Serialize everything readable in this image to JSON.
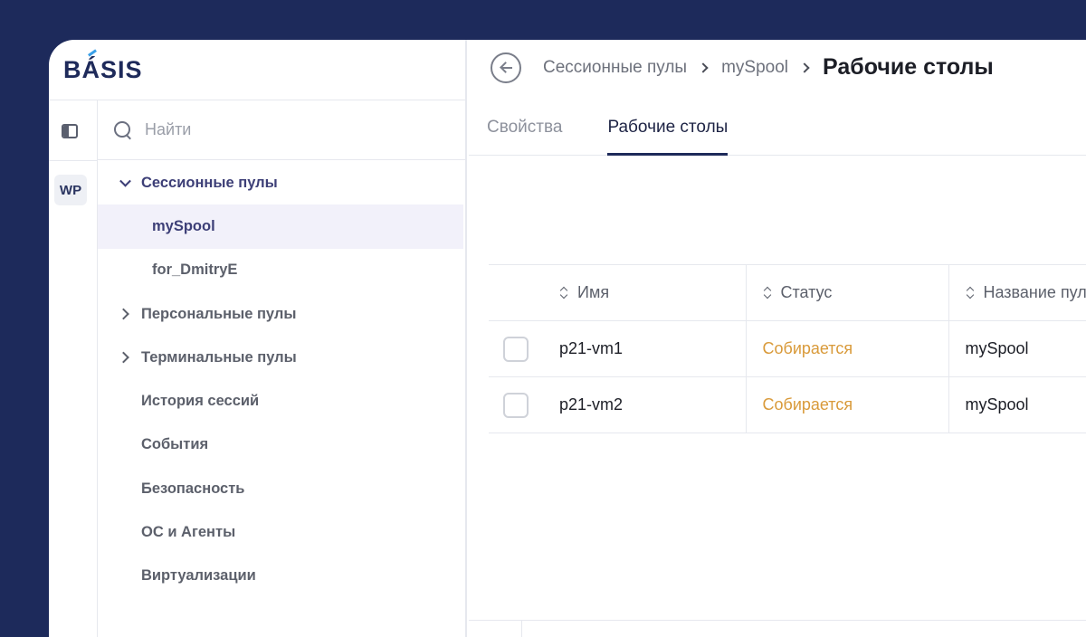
{
  "logo": {
    "text": "BASIS"
  },
  "rail": {
    "workspace_badge": "WP"
  },
  "search": {
    "placeholder": "Найти"
  },
  "sidebar": {
    "items": [
      {
        "label": "Сессионные пулы"
      },
      {
        "label": "mySpool"
      },
      {
        "label": "for_DmitryE"
      },
      {
        "label": "Персональные пулы"
      },
      {
        "label": "Терминальные пулы"
      },
      {
        "label": "История сессий"
      },
      {
        "label": "События"
      },
      {
        "label": "Безопасность"
      },
      {
        "label": "ОС и Агенты"
      },
      {
        "label": "Виртуализации"
      }
    ]
  },
  "breadcrumb": {
    "level1": "Сессионные пулы",
    "level2": "mySpool",
    "current": "Рабочие столы"
  },
  "tabs": [
    {
      "label": "Свойства"
    },
    {
      "label": "Рабочие столы"
    }
  ],
  "table": {
    "columns": [
      "Имя",
      "Статус",
      "Название пула"
    ],
    "rows": [
      {
        "name": "p21-vm1",
        "status": "Собирается",
        "pool": "mySpool"
      },
      {
        "name": "p21-vm2",
        "status": "Собирается",
        "pool": "mySpool"
      }
    ]
  },
  "colors": {
    "background": "#1d2a5b",
    "brand": "#1e2a5a",
    "status_assembling": "#d99a3a",
    "selected_row": "#f2f1fa"
  }
}
